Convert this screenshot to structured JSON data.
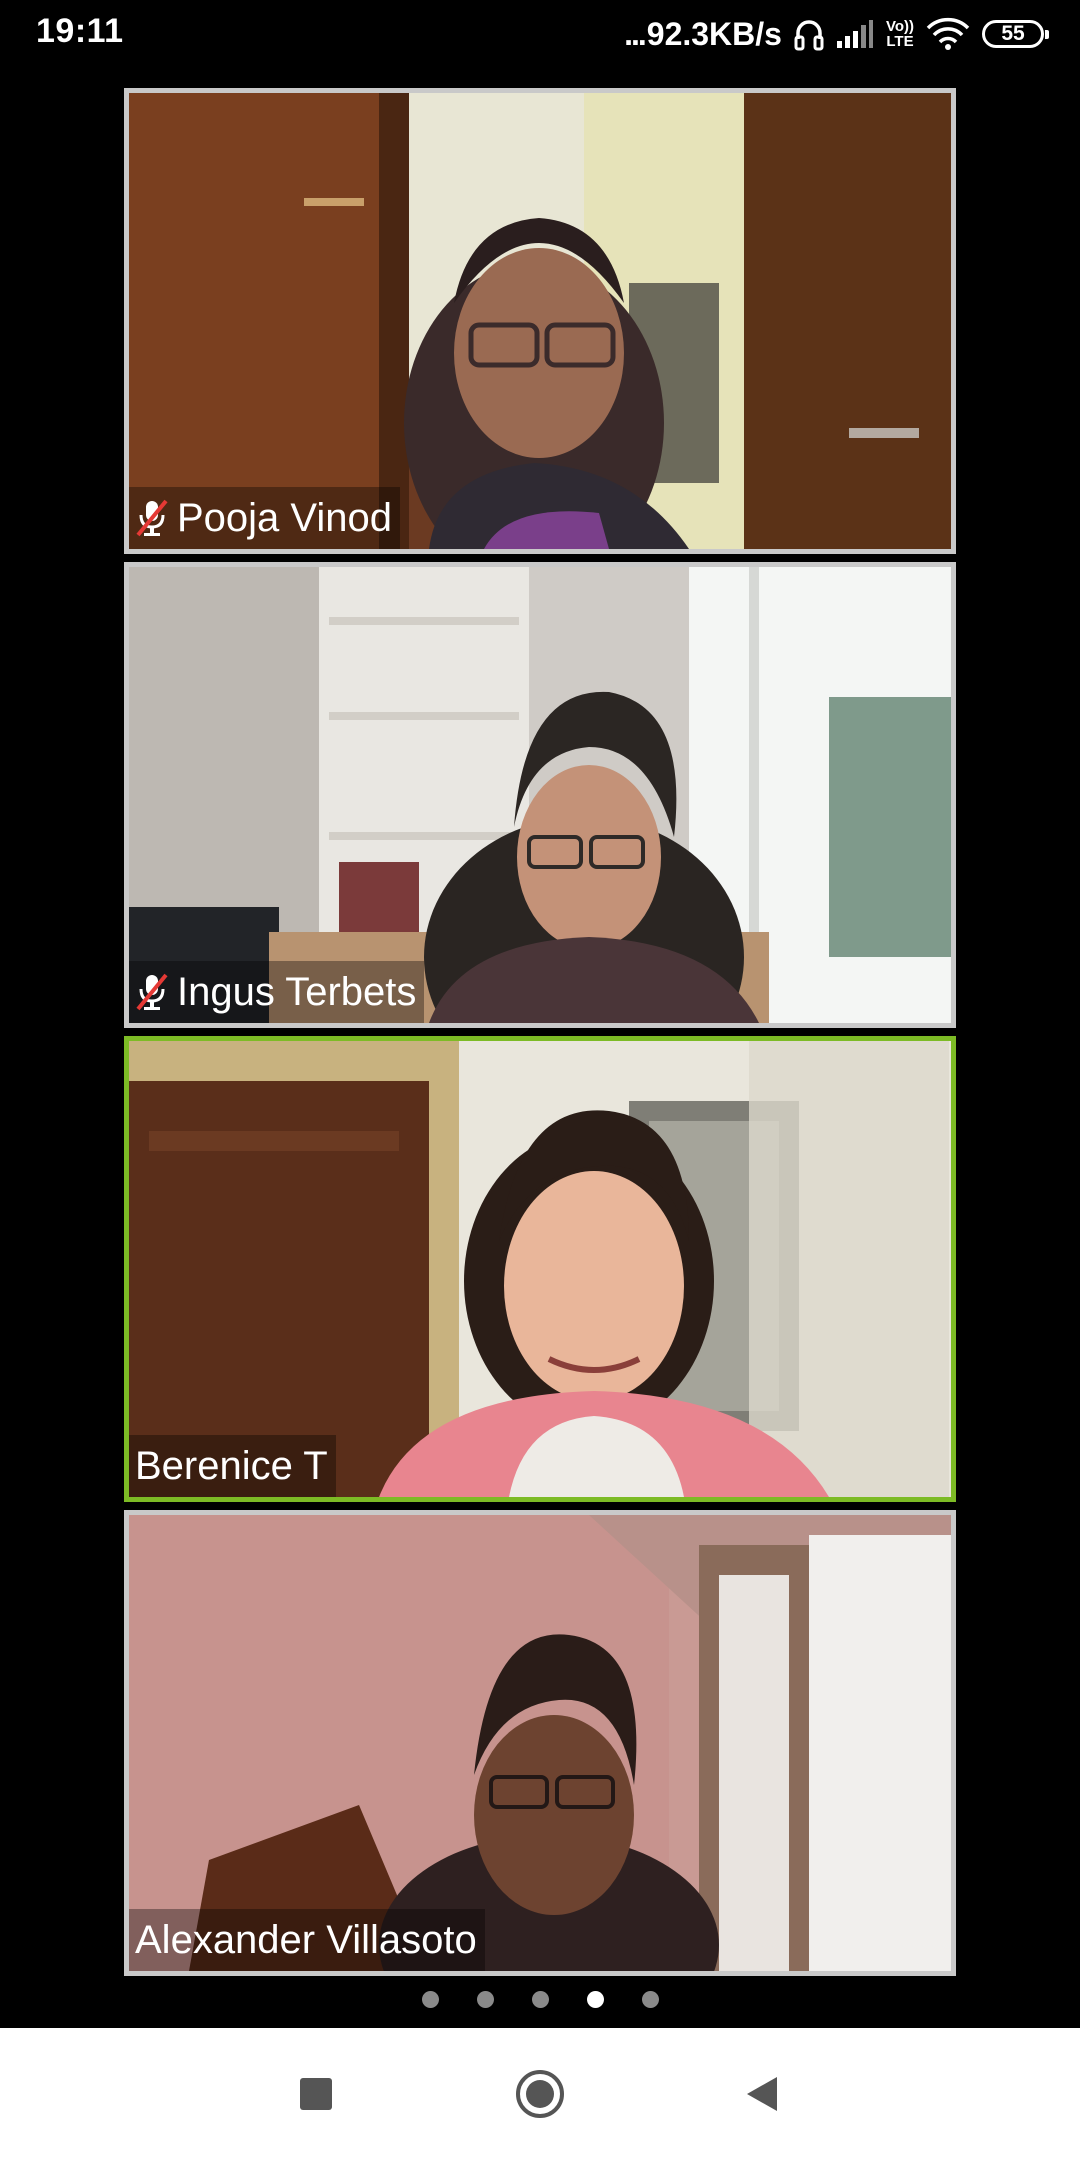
{
  "status_bar": {
    "time": "19:11",
    "net_speed_dots": "...",
    "net_speed": "92.3KB/s",
    "volte_top": "Vo))",
    "volte_bottom": "LTE",
    "battery": "55",
    "icons": [
      "headphones-icon",
      "signal-icon",
      "volte-icon",
      "wifi-icon",
      "battery-icon"
    ]
  },
  "participants": [
    {
      "name": "Pooja Vinod",
      "muted": true,
      "active_speaker": false
    },
    {
      "name": "Ingus Terbets",
      "muted": true,
      "active_speaker": false
    },
    {
      "name": "Berenice T",
      "muted": false,
      "active_speaker": true
    },
    {
      "name": "Alexander Villasoto",
      "muted": false,
      "active_speaker": false
    }
  ],
  "pagination": {
    "total_pages": 5,
    "current_page": 4
  },
  "nav_bar": {
    "icons": [
      "recent-apps-icon",
      "home-icon",
      "back-icon"
    ]
  },
  "colors": {
    "active_speaker_border": "#7dbb25",
    "tile_border": "#c9c9c9",
    "mute": "#e53935"
  }
}
